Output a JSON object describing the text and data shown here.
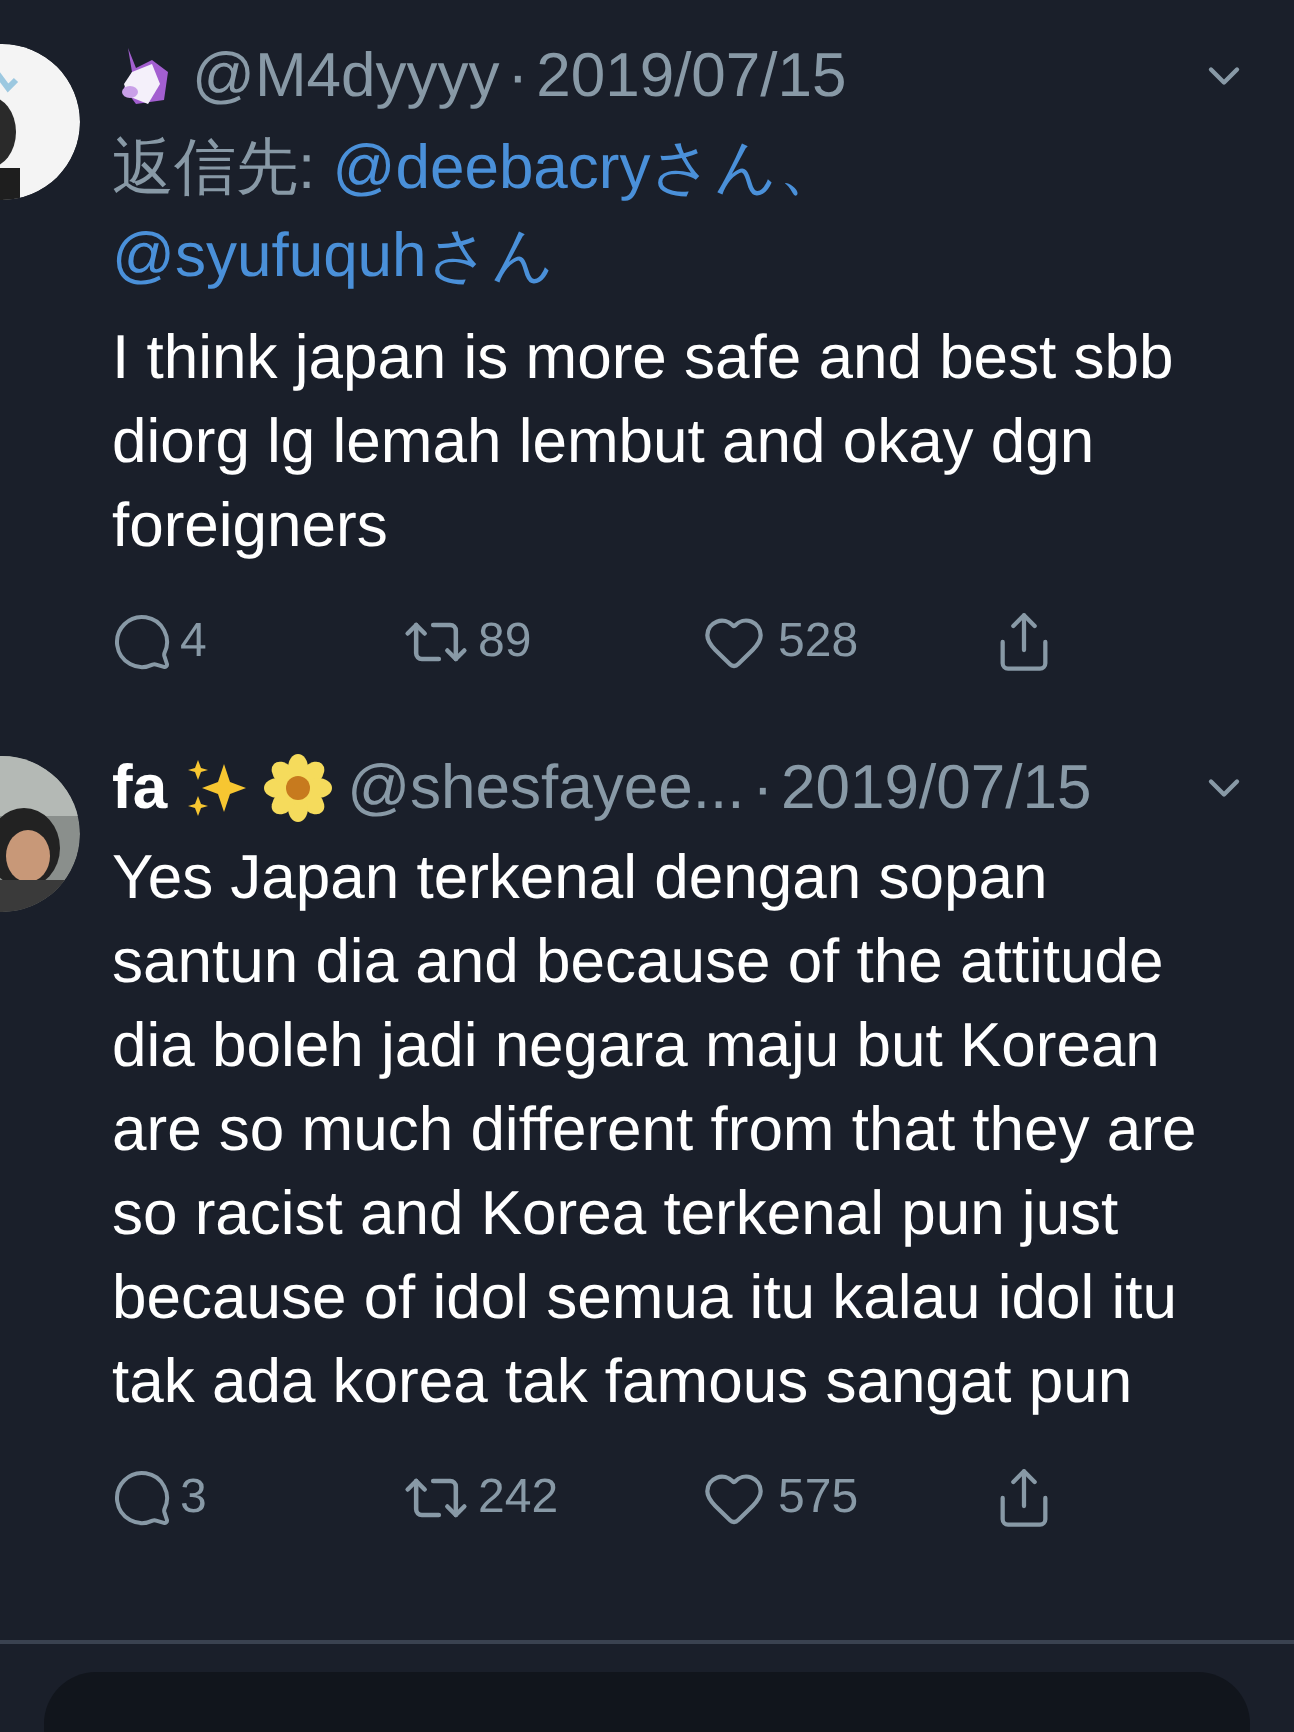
{
  "tweets": [
    {
      "emoji": [
        {
          "kind": "unicorn"
        }
      ],
      "handle": "@M4dyyyy",
      "dot": "·",
      "date": "2019/07/15",
      "reply_to": {
        "label": "返信先:",
        "mentions": [
          "@deebacryさん",
          "@syufuquhさん"
        ],
        "separator": "、"
      },
      "text": "I think japan is more safe and best sbb diorg lg lemah lembut and okay dgn foreigners",
      "replies": "4",
      "retweets": "89",
      "likes": "528"
    },
    {
      "name": "fa",
      "emoji": [
        {
          "kind": "sparkles"
        },
        {
          "kind": "flower"
        }
      ],
      "handle": "@shesfayee...",
      "dot": "·",
      "date": "2019/07/15",
      "text": "Yes Japan terkenal dengan sopan santun dia and because of the attitude dia boleh jadi negara maju but Korean are so much different from that they are so racist and Korea terkenal pun just because of idol semua itu kalau idol itu tak ada korea tak famous sangat pun",
      "replies": "3",
      "retweets": "242",
      "likes": "575"
    }
  ]
}
